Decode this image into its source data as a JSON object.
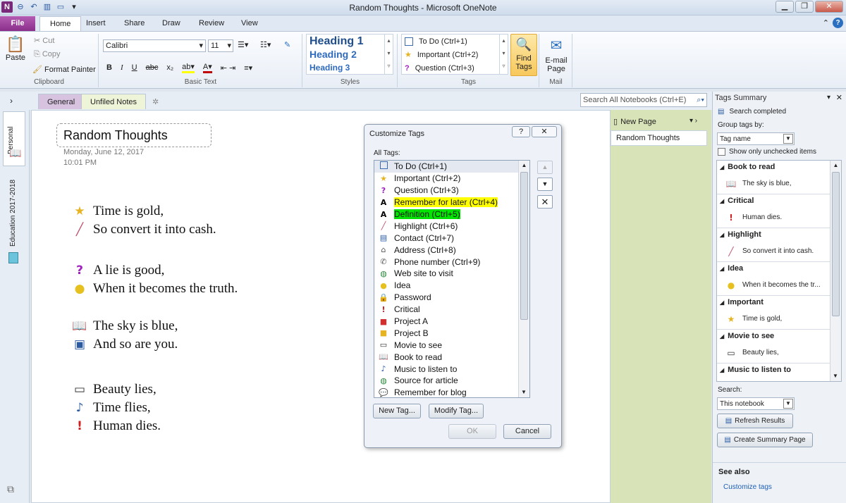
{
  "window": {
    "title": "Random Thoughts - Microsoft OneNote"
  },
  "ribbon_tabs": [
    "Insert",
    "Share",
    "Draw",
    "Review",
    "View"
  ],
  "file_tab": "File",
  "active_tab": "Home",
  "clipboard": {
    "paste": "Paste",
    "cut": "Cut",
    "copy": "Copy",
    "format_painter": "Format Painter",
    "group": "Clipboard"
  },
  "basic_text": {
    "font": "Calibri",
    "size": "11",
    "group": "Basic Text",
    "bold": "B",
    "italic": "I",
    "underline": "U",
    "strike": "abc",
    "subscript": "x₂"
  },
  "styles": {
    "h1": "Heading 1",
    "h2": "Heading 2",
    "h3": "Heading 3",
    "group": "Styles"
  },
  "tags_group": {
    "todo": "To Do (Ctrl+1)",
    "important": "Important (Ctrl+2)",
    "question": "Question (Ctrl+3)",
    "find1": "Find",
    "find2": "Tags",
    "group": "Tags"
  },
  "mail_group": {
    "email1": "E-mail",
    "email2": "Page",
    "group": "Mail"
  },
  "notebook": {
    "sections": [
      "General",
      "Unfiled Notes"
    ],
    "search_placeholder": "Search All Notebooks (Ctrl+E)",
    "side_tabs": [
      "Personal",
      "Education 2017-2018"
    ]
  },
  "page_list": {
    "new_page": "New Page",
    "pages": [
      "Random Thoughts"
    ]
  },
  "page": {
    "title": "Random Thoughts",
    "date": "Monday, June 12, 2017",
    "time": "10:01 PM",
    "notes": [
      [
        "Time is gold,",
        "So convert it into cash."
      ],
      [
        "A lie is good,",
        "When it becomes the truth."
      ],
      [
        "The sky is blue,",
        "And so are you."
      ],
      [
        "Beauty lies,",
        "Time flies,",
        "Human dies."
      ]
    ]
  },
  "dialog": {
    "title": "Customize Tags",
    "help": "?",
    "all_tags_label": "All Tags:",
    "tags": [
      "To Do (Ctrl+1)",
      "Important (Ctrl+2)",
      "Question (Ctrl+3)",
      "Remember for later (Ctrl+4)",
      "Definition (Ctrl+5)",
      "Highlight (Ctrl+6)",
      "Contact (Ctrl+7)",
      "Address (Ctrl+8)",
      "Phone number (Ctrl+9)",
      "Web site to visit",
      "Idea",
      "Password",
      "Critical",
      "Project A",
      "Project B",
      "Movie to see",
      "Book to read",
      "Music to listen to",
      "Source for article",
      "Remember for blog"
    ],
    "new_tag": "New Tag...",
    "modify_tag": "Modify Tag...",
    "ok": "OK",
    "cancel": "Cancel"
  },
  "tags_summary": {
    "title": "Tags Summary",
    "status": "Search completed",
    "group_by_label": "Group tags by:",
    "group_by_value": "Tag name",
    "show_unchecked": "Show only unchecked items",
    "groups": [
      {
        "name": "Book to read",
        "item": "The sky is blue,"
      },
      {
        "name": "Critical",
        "item": "Human dies."
      },
      {
        "name": "Highlight",
        "item": "So convert it into cash."
      },
      {
        "name": "Idea",
        "item": "When it becomes the tr..."
      },
      {
        "name": "Important",
        "item": "Time is gold,"
      },
      {
        "name": "Movie to see",
        "item": "Beauty lies,"
      },
      {
        "name": "Music to listen to",
        "item": ""
      }
    ],
    "search_label": "Search:",
    "search_value": "This notebook",
    "refresh": "Refresh Results",
    "create_summary": "Create Summary Page",
    "see_also": "See also",
    "customize_link": "Customize tags"
  },
  "colors": {
    "file_tab": "#8a2f8a",
    "highlight_yellow": "#ffff00",
    "highlight_green": "#00e600",
    "link": "#1e5fb4"
  }
}
